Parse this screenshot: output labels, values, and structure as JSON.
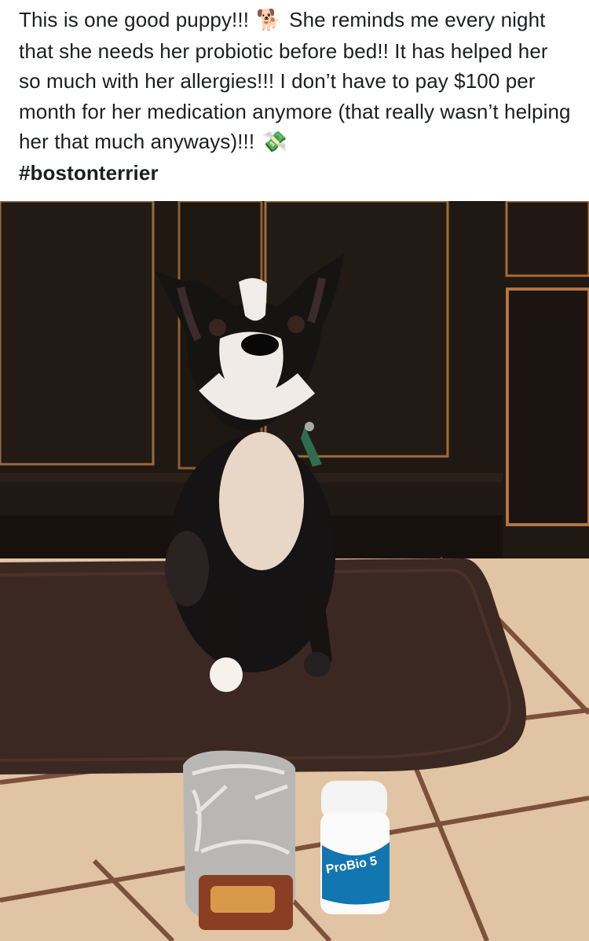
{
  "post": {
    "caption_line_1": "This is one good puppy!!!",
    "emoji_1": "🐕",
    "caption_line_1b": "She reminds me every night that she needs her probiotic before bed!! It has helped her so much with her allergies!!! I don’t have to pay $100 per month for her medication anymore (that really wasn’t helping her that much anyways)!!!",
    "emoji_2": "💸",
    "hashtag": "#bostonterrier",
    "product_label": "ProBio 5",
    "emoji_1_name": "dog-emoji",
    "emoji_2_name": "money-with-wings-emoji"
  },
  "colors": {
    "cabinet": "#1f1813",
    "cabinet_trim": "#a86a35",
    "mat": "#3a2721",
    "tile": "#e3c6a4",
    "grout": "#7a4f39"
  }
}
